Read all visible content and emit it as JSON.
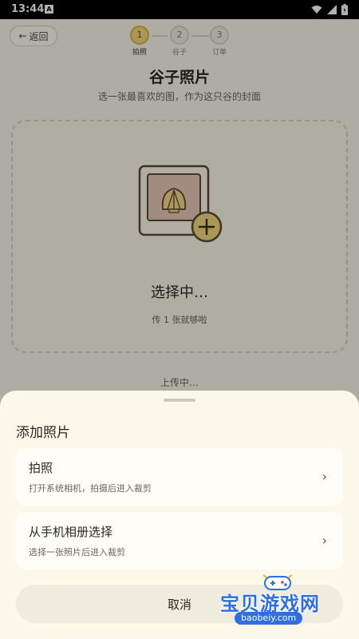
{
  "status": {
    "time": "13:44",
    "notif_glyph": "A"
  },
  "header": {
    "back_label": "返回"
  },
  "steps": [
    {
      "num": "1",
      "label": "拍照",
      "active": true
    },
    {
      "num": "2",
      "label": "谷子",
      "active": false
    },
    {
      "num": "3",
      "label": "订单",
      "active": false
    }
  ],
  "page": {
    "title": "谷子照片",
    "subtitle": "选一张最喜欢的图，作为这只谷的封面"
  },
  "upload": {
    "title": "选择中…",
    "hint": "传 1 张就够啦",
    "icon": "shell-photo-add-icon"
  },
  "uploading_text": "上传中…",
  "sheet": {
    "title": "添加照片",
    "options": [
      {
        "title": "拍照",
        "desc": "打开系统相机，拍摄后进入裁剪",
        "chevron": "›"
      },
      {
        "title": "从手机相册选择",
        "desc": "选择一张照片后进入裁剪",
        "chevron": "›"
      }
    ],
    "cancel": "取消"
  },
  "watermark": {
    "text": "宝贝游戏网",
    "url": "baobeiy.com"
  },
  "colors": {
    "accent": "#f4d77a",
    "accent_border": "#d9b44a",
    "watermark": "#2f6fe0"
  }
}
